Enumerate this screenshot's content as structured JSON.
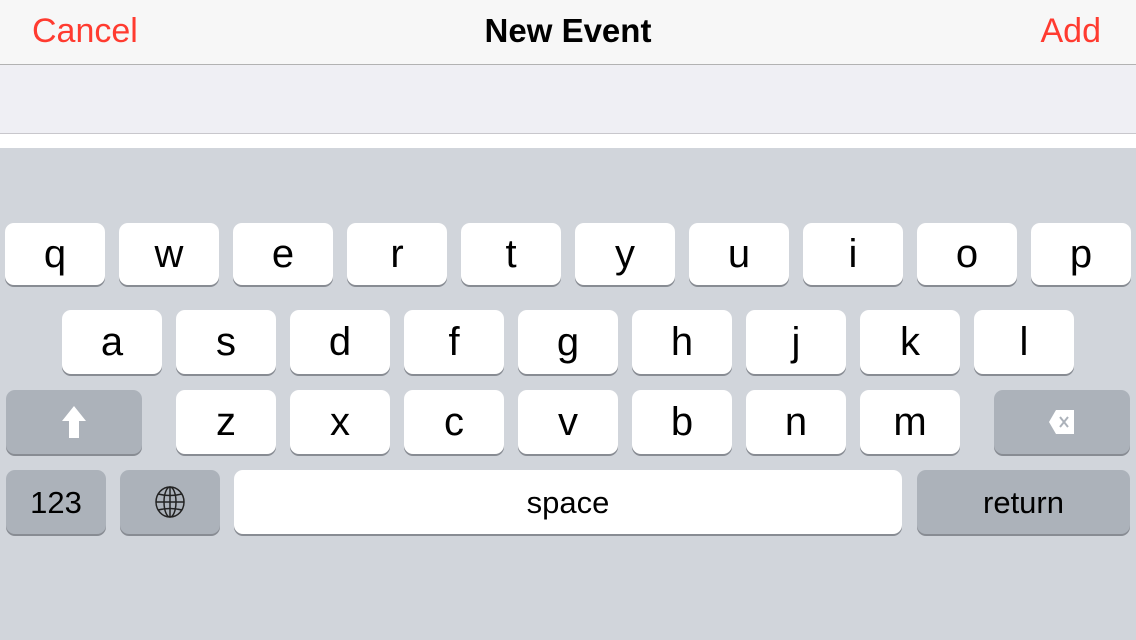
{
  "navbar": {
    "cancel_label": "Cancel",
    "title": "New Event",
    "add_label": "Add",
    "accent_color": "#ff3b30"
  },
  "keyboard": {
    "row1": [
      "q",
      "w",
      "e",
      "r",
      "t",
      "y",
      "u",
      "i",
      "o",
      "p"
    ],
    "row2": [
      "a",
      "s",
      "d",
      "f",
      "g",
      "h",
      "j",
      "k",
      "l"
    ],
    "row3": [
      "z",
      "x",
      "c",
      "v",
      "b",
      "n",
      "m"
    ],
    "shift_icon": "shift-arrow-icon",
    "delete_icon": "backspace-icon",
    "numbers_label": "123",
    "globe_icon": "globe-icon",
    "space_label": "space",
    "return_label": "return"
  }
}
